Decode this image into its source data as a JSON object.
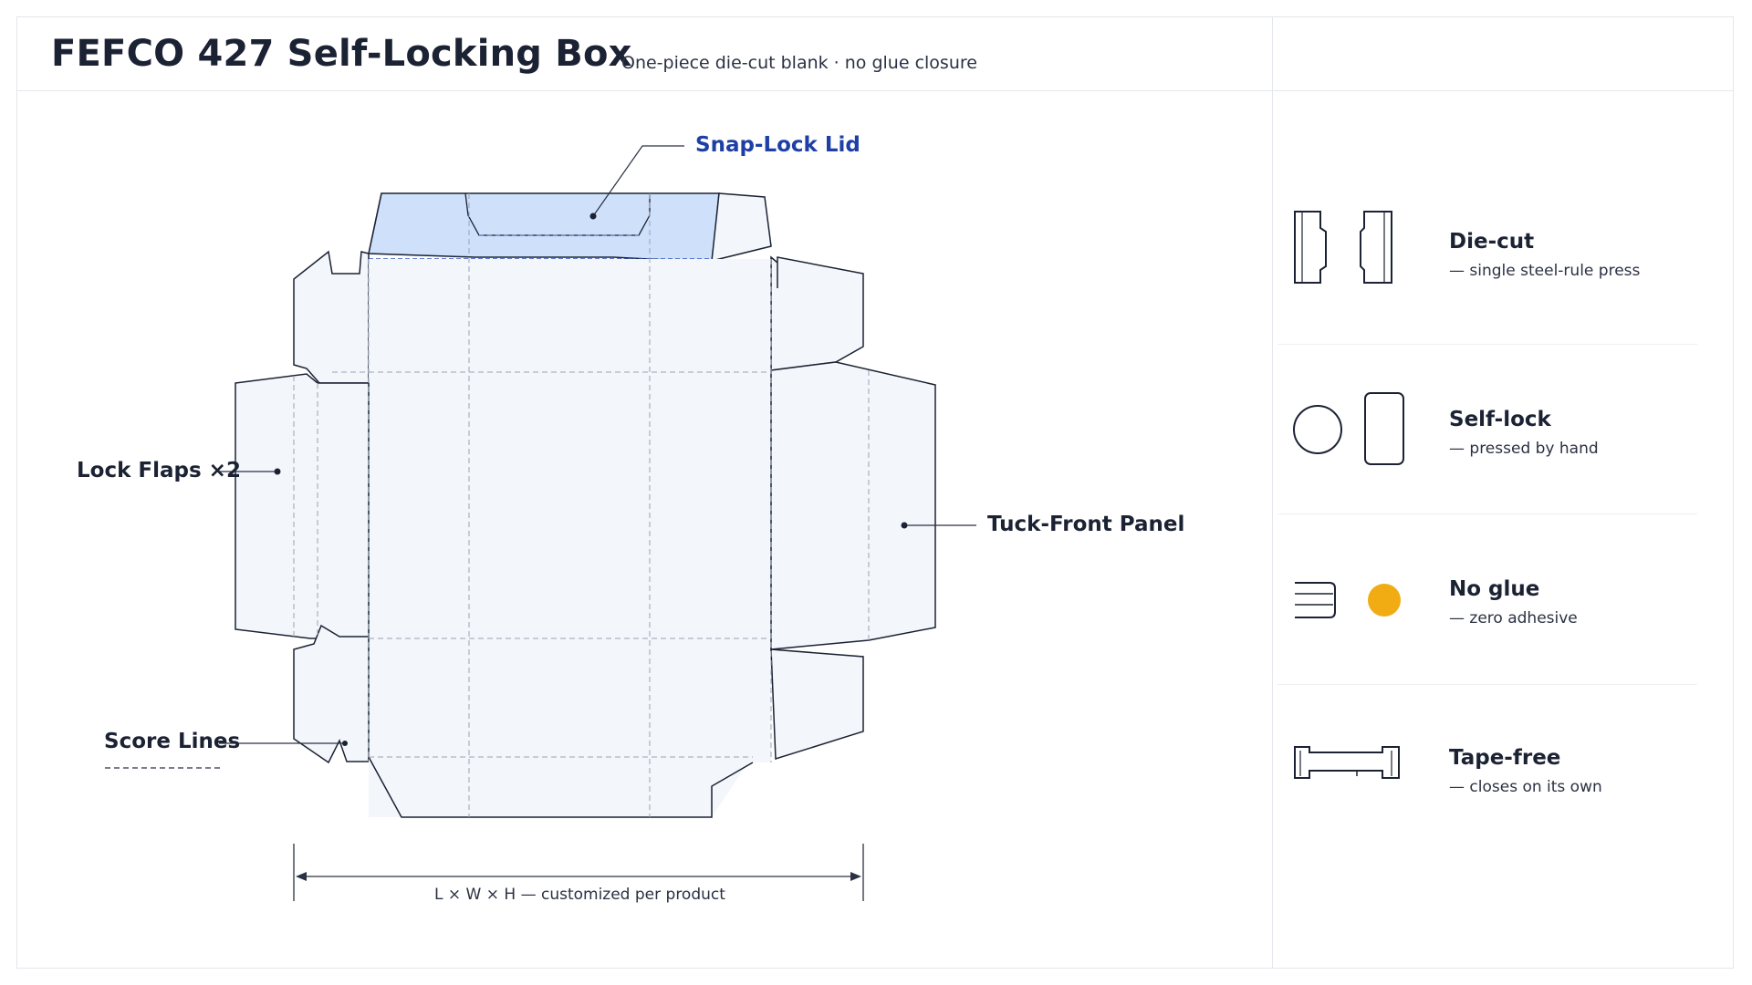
{
  "header": {
    "title": "FEFCO 427  Self-Locking Box",
    "subtitle": "One-piece die-cut blank  ·  no glue closure"
  },
  "diagram": {
    "callouts": {
      "lid": "Snap-Lock Lid",
      "lock_flaps": "Lock Flaps ×2",
      "tuck_front": "Tuck-Front Panel",
      "score_lines": "Score Lines"
    },
    "dimension": "L  ×  W  ×  H  —  customized per product"
  },
  "features": [
    {
      "title": "Die-cut",
      "desc": "— single steel-rule press",
      "icon": "die-cut-icon"
    },
    {
      "title": "Self-lock",
      "desc": "— pressed  by hand",
      "icon": "self-lock-icon"
    },
    {
      "title": "No glue",
      "desc": "— zero adhesive",
      "icon": "no-glue-icon"
    },
    {
      "title": "Tape-free",
      "desc": "— closes on its own",
      "icon": "tape-free-icon"
    }
  ],
  "colors": {
    "ink": "#1b2233",
    "accent_blue": "#1e3fa6",
    "lid_fill": "#cfe0fa",
    "panel_fill": "#f3f6fb",
    "amber": "#f0ac12"
  }
}
